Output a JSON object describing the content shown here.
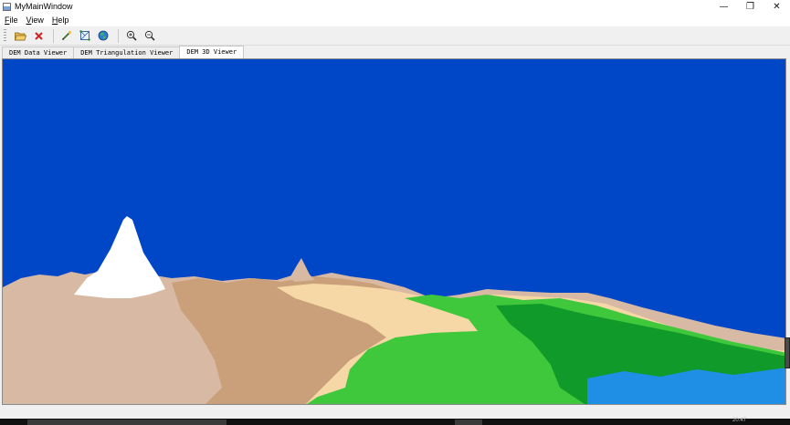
{
  "window": {
    "title": "MyMainWindow",
    "controls": {
      "minimize": "—",
      "restore": "❐",
      "close": "✕"
    }
  },
  "menu": {
    "items": [
      {
        "accel": "F",
        "rest": "ile"
      },
      {
        "accel": "V",
        "rest": "iew"
      },
      {
        "accel": "H",
        "rest": "elp"
      }
    ]
  },
  "toolbar": {
    "buttons": [
      {
        "icon": "open-folder-icon"
      },
      {
        "icon": "close-red-x-icon"
      },
      {
        "icon": "pencil-wand-icon"
      },
      {
        "icon": "triangulation-icon"
      },
      {
        "icon": "globe-icon"
      },
      {
        "icon": "zoom-in-icon"
      },
      {
        "icon": "zoom-out-icon"
      }
    ]
  },
  "tabs": [
    {
      "label": "DEM Data Viewer",
      "active": false
    },
    {
      "label": "DEM Triangulation Viewer",
      "active": false
    },
    {
      "label": "DEM 3D Viewer",
      "active": true
    }
  ],
  "viewport": {
    "colors": {
      "sky": "#0047c8",
      "snow": "#ffffff",
      "rock": "#d8b9a3",
      "brown": "#c9a07a",
      "sand": "#f6d8a7",
      "grass": "#3fc83c",
      "forest": "#0f9a2a",
      "water": "#1f8fe6"
    }
  },
  "taskbar": {
    "clock": "20:47"
  }
}
